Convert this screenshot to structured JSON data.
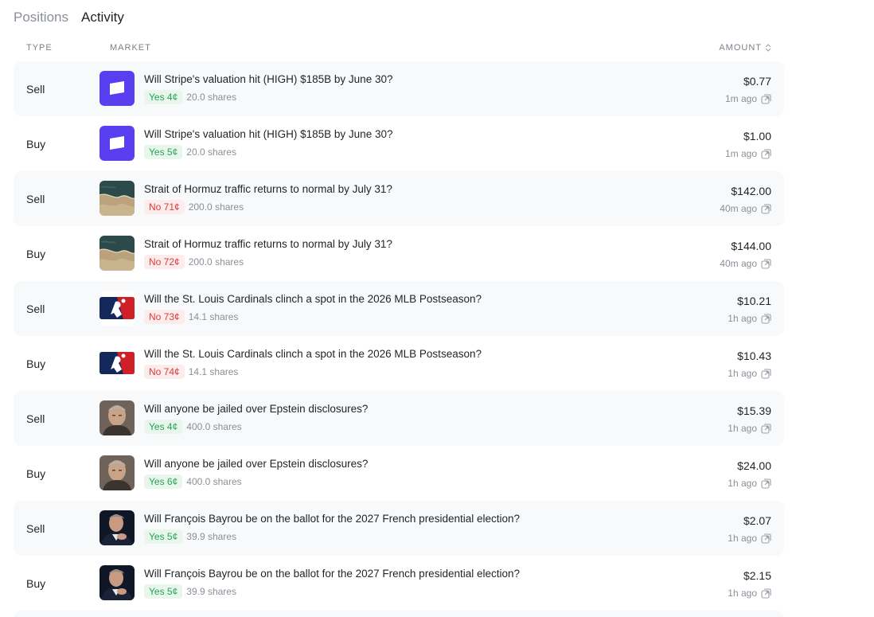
{
  "tabs": {
    "positions": "Positions",
    "activity": "Activity"
  },
  "columns": {
    "type": "TYPE",
    "market": "MARKET",
    "amount": "AMOUNT"
  },
  "colors": {
    "yes_text": "#23a455",
    "yes_bg": "#e8f6ec",
    "no_text": "#dc3b3b",
    "no_bg": "#fdecec",
    "stripe_purple": "#5a3ff0",
    "mlb_navy": "#13285b",
    "mlb_red": "#cf2027"
  },
  "rows": [
    {
      "type": "Sell",
      "title": "Will Stripe's valuation hit (HIGH) $185B by June 30?",
      "outcome": "Yes 4¢",
      "outcome_kind": "yes",
      "shares": "20.0 shares",
      "amount": "$0.77",
      "time": "1m ago",
      "icon": "stripe-icon"
    },
    {
      "type": "Buy",
      "title": "Will Stripe's valuation hit (HIGH) $185B by June 30?",
      "outcome": "Yes 5¢",
      "outcome_kind": "yes",
      "shares": "20.0 shares",
      "amount": "$1.00",
      "time": "1m ago",
      "icon": "stripe-icon"
    },
    {
      "type": "Sell",
      "title": "Strait of Hormuz traffic returns to normal by July 31?",
      "outcome": "No 71¢",
      "outcome_kind": "no",
      "shares": "200.0 shares",
      "amount": "$142.00",
      "time": "40m ago",
      "icon": "strait-map-image"
    },
    {
      "type": "Buy",
      "title": "Strait of Hormuz traffic returns to normal by July 31?",
      "outcome": "No 72¢",
      "outcome_kind": "no",
      "shares": "200.0 shares",
      "amount": "$144.00",
      "time": "40m ago",
      "icon": "strait-map-image"
    },
    {
      "type": "Sell",
      "title": "Will the St. Louis Cardinals clinch a spot in the 2026 MLB Postseason?",
      "outcome": "No 73¢",
      "outcome_kind": "no",
      "shares": "14.1 shares",
      "amount": "$10.21",
      "time": "1h ago",
      "icon": "mlb-logo-icon"
    },
    {
      "type": "Buy",
      "title": "Will the St. Louis Cardinals clinch a spot in the 2026 MLB Postseason?",
      "outcome": "No 74¢",
      "outcome_kind": "no",
      "shares": "14.1 shares",
      "amount": "$10.43",
      "time": "1h ago",
      "icon": "mlb-logo-icon"
    },
    {
      "type": "Sell",
      "title": "Will anyone be jailed over Epstein disclosures?",
      "outcome": "Yes 4¢",
      "outcome_kind": "yes",
      "shares": "400.0 shares",
      "amount": "$15.39",
      "time": "1h ago",
      "icon": "person-portrait"
    },
    {
      "type": "Buy",
      "title": "Will anyone be jailed over Epstein disclosures?",
      "outcome": "Yes 6¢",
      "outcome_kind": "yes",
      "shares": "400.0 shares",
      "amount": "$24.00",
      "time": "1h ago",
      "icon": "person-portrait"
    },
    {
      "type": "Sell",
      "title": "Will François Bayrou be on the ballot for the 2027 French presidential election?",
      "outcome": "Yes 5¢",
      "outcome_kind": "yes",
      "shares": "39.9 shares",
      "amount": "$2.07",
      "time": "1h ago",
      "icon": "person-portrait-dark"
    },
    {
      "type": "Buy",
      "title": "Will François Bayrou be on the ballot for the 2027 French presidential election?",
      "outcome": "Yes 5¢",
      "outcome_kind": "yes",
      "shares": "39.9 shares",
      "amount": "$2.15",
      "time": "1h ago",
      "icon": "person-portrait-dark"
    }
  ]
}
